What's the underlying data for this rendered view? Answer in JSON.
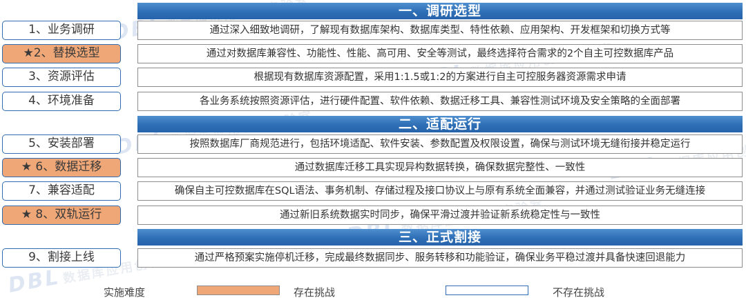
{
  "watermark": "数据库应用创新实验室",
  "watermark_logo": "DBL",
  "sections": [
    "一、调研选型",
    "二、适配运行",
    "三、正式割接"
  ],
  "steps": [
    {
      "label": "1、业务调研",
      "desc": "通过深入细致地调研，了解现有数据库架构、数据库类型、特性依赖、应用架构、开发框架和切换方式等"
    },
    {
      "label": "★2、替换选型",
      "desc": "通过对数据库兼容性、功能性、性能、高可用、安全等测试，最终选择符合需求的2个自主可控数据库产品"
    },
    {
      "label": "3、资源评估",
      "desc": "根据现有数据库资源配置，采用1:1.5或1:2的方案进行自主可控服务器资源需求申请"
    },
    {
      "label": "4、环境准备",
      "desc": "各业务系统按照资源评估，进行硬件配置、软件依赖、数据迁移工具、兼容性测试环境及安全策略的全面部署"
    },
    {
      "label": "5、安装部署",
      "desc": "按照数据库厂商规范进行，包括环境适配、软件安装、参数配置及权限设置，确保与测试环境无缝衔接并稳定运行"
    },
    {
      "label": "★ 6、数据迁移",
      "desc": "通过数据库迁移工具实现异构数据转换，确保数据完整性、一致性"
    },
    {
      "label": "7、兼容适配",
      "desc": "确保自主可控数据库在SQL语法、事务机制、存储过程及接口协议上与原有系统全面兼容，并通过测试验证业务无缝连接"
    },
    {
      "label": "★ 8、双轨运行",
      "desc": "通过新旧系统数据实时同步，确保平滑过渡并验证新系统稳定性与一致性"
    },
    {
      "label": "9、割接上线",
      "desc": "通过严格预案实施停机迁移，完成最终数据同步、服务转移和功能验证，确保业务平稳过渡并具备快速回退能力"
    }
  ],
  "legend": {
    "title": "实施难度",
    "challenge": "存在挑战",
    "no_challenge": "不存在挑战",
    "challenge_color": "#f0a777",
    "border_color": "#2f6bb0"
  }
}
